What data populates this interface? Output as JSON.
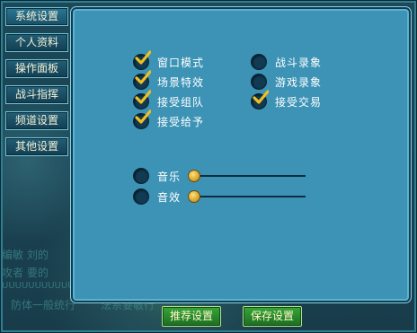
{
  "sidebar": {
    "items": [
      {
        "label": "系统设置"
      },
      {
        "label": "个人资料"
      },
      {
        "label": "操作面板"
      },
      {
        "label": "战斗指挥"
      },
      {
        "label": "频道设置"
      },
      {
        "label": "其他设置"
      }
    ]
  },
  "options": {
    "left": [
      {
        "label": "窗口模式",
        "checked": true
      },
      {
        "label": "场景特效",
        "checked": true
      },
      {
        "label": "接受组队",
        "checked": true
      },
      {
        "label": "接受给予",
        "checked": true
      }
    ],
    "right": [
      {
        "label": "战斗录象",
        "checked": false
      },
      {
        "label": "游戏录象",
        "checked": false
      },
      {
        "label": "接受交易",
        "checked": true
      }
    ]
  },
  "audio": {
    "music": {
      "label": "音乐",
      "enabled": false,
      "level": 0
    },
    "sound": {
      "label": "音效",
      "enabled": false,
      "level": 0
    }
  },
  "buttons": {
    "recommend": "推荐设置",
    "save": "保存设置"
  },
  "background_text": [
    "编敏  刘的",
    "攻者  要的",
    "UUUUUUUUUUUUUU",
    "防体一般统行",
    "法系要敏行"
  ],
  "colors": {
    "panel": "#3c93b5",
    "check": "#f0c020",
    "button_green": "#2e8f31"
  }
}
